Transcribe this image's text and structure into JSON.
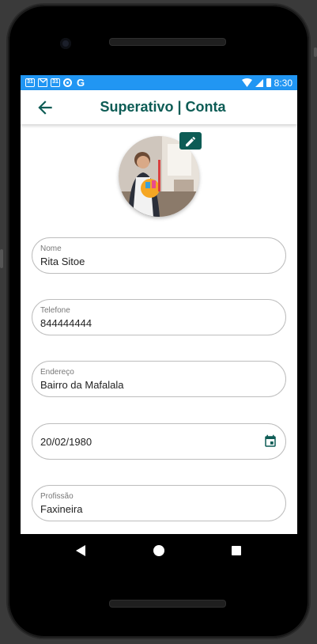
{
  "status_bar": {
    "icons": [
      "calendar-icon",
      "gmail-icon",
      "calendar-icon",
      "chrome-icon",
      "google-icon"
    ],
    "notif_calendar_1": "31",
    "notif_calendar_2": "31",
    "notif_google": "G",
    "time": "8:30"
  },
  "app_bar": {
    "title": "Superativo | Conta",
    "back_icon": "arrow-back-icon",
    "accent_color": "#0d5c55"
  },
  "profile": {
    "edit_icon": "pencil-icon"
  },
  "form": {
    "nome": {
      "label": "Nome",
      "value": "Rita Sitoe"
    },
    "telefone": {
      "label": "Telefone",
      "value": "844444444"
    },
    "endereco": {
      "label": "Endereço",
      "value": "Bairro da Mafalala"
    },
    "data": {
      "value": "20/02/1980",
      "icon": "calendar-icon"
    },
    "profissao": {
      "label": "Profissão",
      "value": "Faxineira"
    }
  },
  "colors": {
    "status_bar": "#2196f3",
    "primary": "#0d5c55",
    "field_border": "#bdbdbd"
  }
}
